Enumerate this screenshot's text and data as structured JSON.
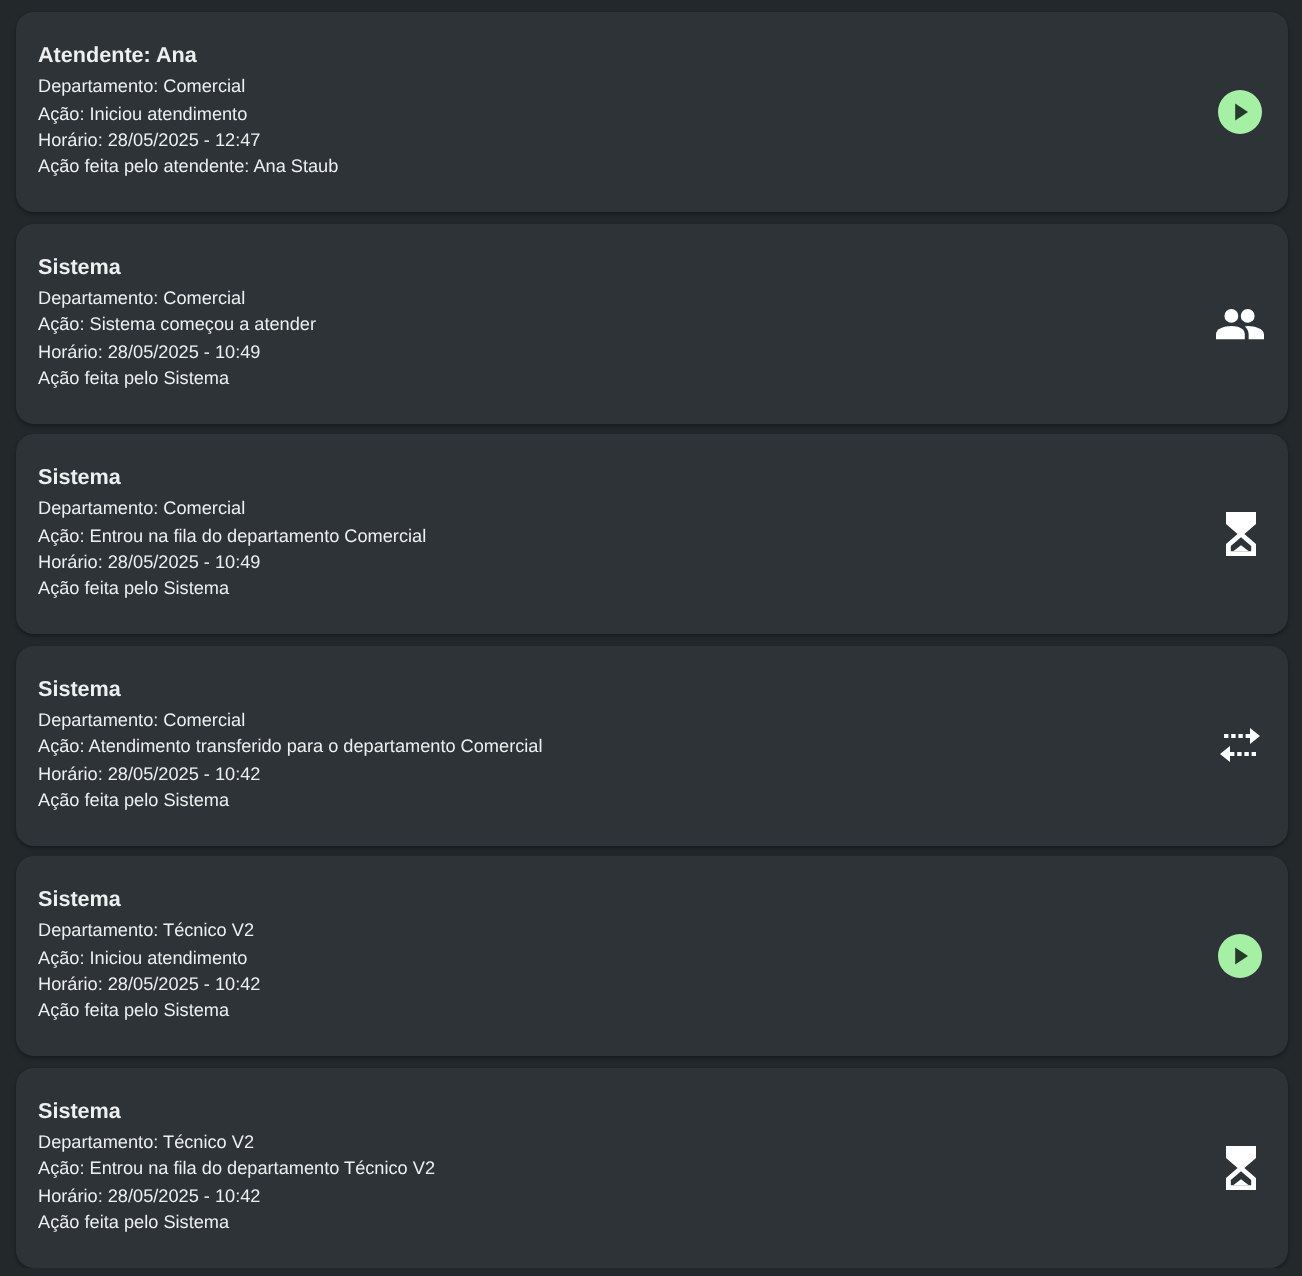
{
  "events": [
    {
      "title": "Atendente: Ana",
      "department": "Departamento: Comercial",
      "action": "Ação: Iniciou atendimento",
      "time": "Horário: 28/05/2025 - 12:47",
      "actor": "Ação feita pelo atendente: Ana Staub",
      "kind": "start"
    },
    {
      "title": "Sistema",
      "department": "Departamento: Comercial",
      "action": "Ação: Sistema começou a atender",
      "time": "Horário: 28/05/2025 - 10:49",
      "actor": "Ação feita pelo Sistema",
      "kind": "attend"
    },
    {
      "title": "Sistema",
      "department": "Departamento: Comercial",
      "action": "Ação: Entrou na fila do departamento Comercial",
      "time": "Horário: 28/05/2025 - 10:49",
      "actor": "Ação feita pelo Sistema",
      "kind": "queue"
    },
    {
      "title": "Sistema",
      "department": "Departamento: Comercial",
      "action": "Ação: Atendimento transferido para o departamento Comercial",
      "time": "Horário: 28/05/2025 - 10:42",
      "actor": "Ação feita pelo Sistema",
      "kind": "transfer"
    },
    {
      "title": "Sistema",
      "department": "Departamento: Técnico V2",
      "action": "Ação: Iniciou atendimento",
      "time": "Horário: 28/05/2025 - 10:42",
      "actor": "Ação feita pelo Sistema",
      "kind": "start"
    },
    {
      "title": "Sistema",
      "department": "Departamento: Técnico V2",
      "action": "Ação: Entrou na fila do departamento Técnico V2",
      "time": "Horário: 28/05/2025 - 10:42",
      "actor": "Ação feita pelo Sistema",
      "kind": "queue"
    }
  ]
}
